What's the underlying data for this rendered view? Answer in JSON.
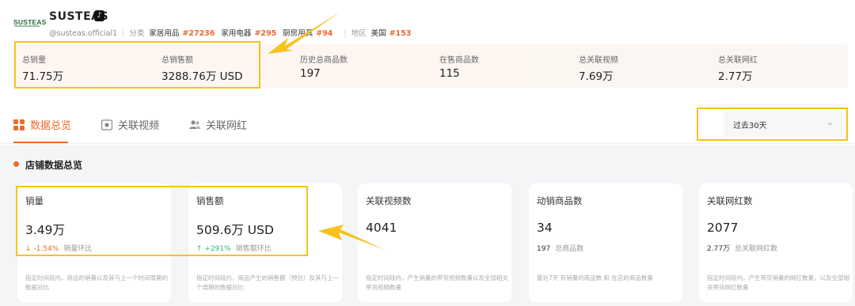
{
  "shop": {
    "logo_text": "SUSTEAS",
    "name": "SUSTEAS",
    "handle": "@susteas.official1",
    "category_key": "分类",
    "categories": [
      {
        "name": "家居用品",
        "rank": "#27236"
      },
      {
        "name": "家用电器",
        "rank": "#295"
      },
      {
        "name": "厨房用具",
        "rank": "#94"
      }
    ],
    "region_key": "地区",
    "region": {
      "name": "美国",
      "rank": "#153"
    }
  },
  "overview": [
    {
      "label": "总销量",
      "value": "71.75万"
    },
    {
      "label": "总销售额",
      "value": "3288.76万 USD"
    },
    {
      "label": "历史总商品数",
      "value": "197"
    },
    {
      "label": "在售商品数",
      "value": "115"
    },
    {
      "label": "总关联视频",
      "value": "7.69万"
    },
    {
      "label": "总关联网红",
      "value": "2.77万"
    }
  ],
  "tabs": [
    {
      "label": "数据总览",
      "icon": "grid-icon",
      "active": true
    },
    {
      "label": "关联视频",
      "icon": "video-icon",
      "active": false
    },
    {
      "label": "关联网红",
      "icon": "users-icon",
      "active": false
    }
  ],
  "period_select": {
    "value": "过去30天"
  },
  "section": {
    "title": "店铺数据总览"
  },
  "cards": [
    {
      "title": "销量",
      "value": "3.49万",
      "change": "↓ -1.54%",
      "change_label": "销量环比",
      "desc": "指定时间段内，商品的销量以及其与上一个时间周期的数据对比"
    },
    {
      "title": "销售额",
      "value": "509.6万 USD",
      "change": "↑ +291%",
      "change_label": "销售额环比",
      "desc": "指定时间段内，商品产生的销售额（预估）及其与上一个周期的数据对比"
    },
    {
      "title": "关联视频数",
      "value": "4041",
      "desc": "指定时间段内，产生销量的带货视频数量以及全部相关带货视频数量"
    },
    {
      "title": "动销商品数",
      "value": "34",
      "sub_num": "197",
      "sub_label": "总商品数",
      "desc": "最近7天 有销量的商品数 和 在店的商品数量"
    },
    {
      "title": "关联网红数",
      "value": "2077",
      "sub_num": "2.77万",
      "sub_label": "总关联网红数",
      "desc": "指定时间段内，产生带货销量的网红数量，以及全部相关带货网红数量"
    }
  ],
  "colors": {
    "accent": "#ef6b2a",
    "highlight": "#f7c21b",
    "up": "#2fb383"
  }
}
